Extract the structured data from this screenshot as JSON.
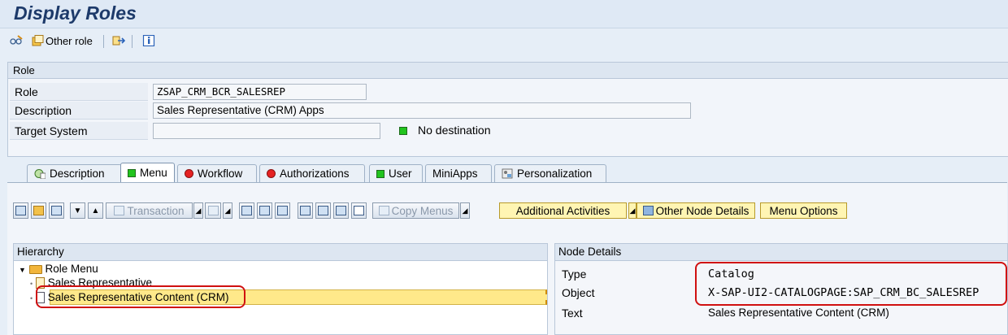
{
  "window": {
    "title": "Display Roles"
  },
  "app_toolbar": {
    "other_role_label": "Other role"
  },
  "role_panel": {
    "header": "Role",
    "role_label": "Role",
    "role_value": "ZSAP_CRM_BCR_SALESREP",
    "description_label": "Description",
    "description_value": "Sales Representative (CRM) Apps",
    "target_system_label": "Target System",
    "target_system_value": "",
    "destination_status": "No destination"
  },
  "tabs": [
    {
      "label": "Description",
      "status": "info"
    },
    {
      "label": "Menu",
      "status": "green",
      "active": true
    },
    {
      "label": "Workflow",
      "status": "red"
    },
    {
      "label": "Authorizations",
      "status": "red"
    },
    {
      "label": "User",
      "status": "green"
    },
    {
      "label": "MiniApps",
      "status": "none"
    },
    {
      "label": "Personalization",
      "status": "info"
    }
  ],
  "menu_toolbar": {
    "transaction_label": "Transaction",
    "copy_menus_label": "Copy Menus",
    "additional_activities_label": "Additional Activities",
    "other_node_details_label": "Other Node Details",
    "menu_options_label": "Menu Options"
  },
  "hierarchy": {
    "header": "Hierarchy",
    "items": [
      {
        "label": "Role Menu"
      },
      {
        "label": "Sales Representative"
      },
      {
        "label": "Sales Representative Content (CRM)",
        "selected": true
      }
    ]
  },
  "node_details": {
    "header": "Node Details",
    "type_label": "Type",
    "type_value": "Catalog",
    "object_label": "Object",
    "object_value": "X-SAP-UI2-CATALOGPAGE:SAP_CRM_BC_SALESREP",
    "text_label": "Text",
    "text_value": "Sales Representative Content (CRM)"
  },
  "colors": {
    "status_green": "#22c41e",
    "status_red": "#e52222",
    "highlight_red": "#d01010",
    "selection_yellow": "#ffe98a"
  }
}
